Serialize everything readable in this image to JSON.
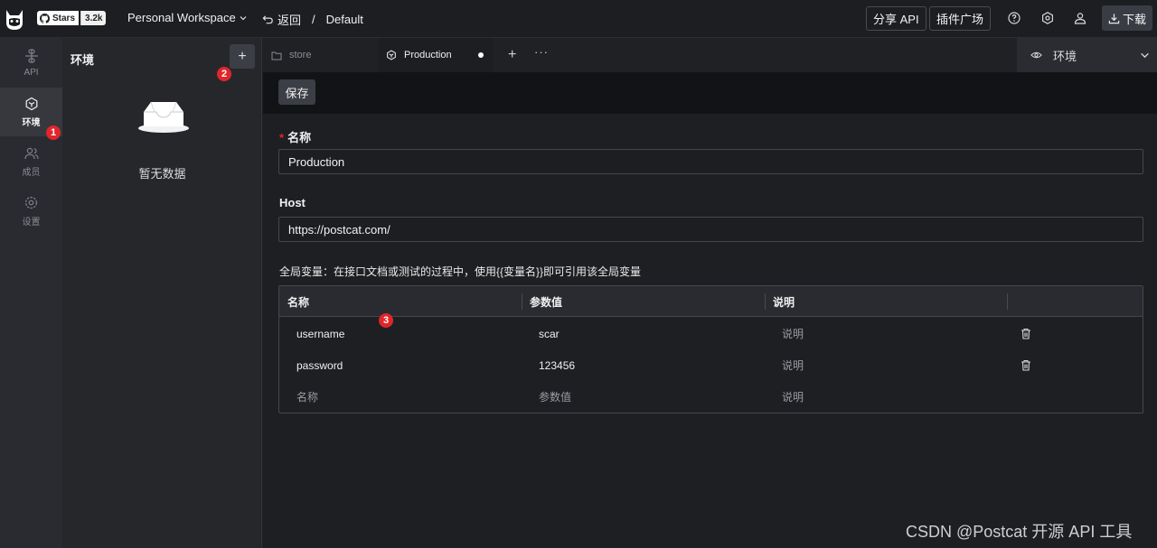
{
  "topbar": {
    "github_badge": {
      "label": "Stars",
      "count": "3.2k"
    },
    "workspace": "Personal Workspace",
    "back_label": "返回",
    "breadcrumb_separator": "/",
    "breadcrumb_current": "Default",
    "share_api": "分享 API",
    "plugin_market": "插件广场",
    "download": "下载",
    "icons": [
      "help-icon",
      "settings-icon",
      "user-icon",
      "download-icon"
    ]
  },
  "leftnav": {
    "items": [
      {
        "label": "API",
        "icon": "api-icon"
      },
      {
        "label": "环境",
        "icon": "environment-icon",
        "active": true
      },
      {
        "label": "成员",
        "icon": "members-icon"
      },
      {
        "label": "设置",
        "icon": "settings-icon"
      }
    ]
  },
  "env_panel": {
    "title": "环境",
    "add_label": "+",
    "empty_text": "暂无数据"
  },
  "annotations": [
    "1",
    "2",
    "3"
  ],
  "tabs": {
    "items": [
      {
        "label": "store",
        "icon": "folder-icon",
        "active": false
      },
      {
        "label": "Production",
        "icon": "environment-icon",
        "active": true,
        "unsaved": true
      }
    ],
    "add_label": "+",
    "more_label": "···",
    "env_select": "环境"
  },
  "toolbar": {
    "save_label": "保存"
  },
  "form": {
    "name_label": "名称",
    "name_value": "Production",
    "host_label": "Host",
    "host_value": "https://postcat.com/",
    "hint": "全局变量：在接口文档或测试的过程中，使用{{变量名}}即可引用该全局变量"
  },
  "variables": {
    "headers": [
      "名称",
      "参数值",
      "说明"
    ],
    "rows": [
      {
        "name": "username",
        "value": "scar",
        "desc": "说明"
      },
      {
        "name": "password",
        "value": "123456",
        "desc": "说明"
      }
    ],
    "placeholder": {
      "name": "名称",
      "value": "参数值",
      "desc": "说明"
    }
  },
  "watermark": "CSDN @Postcat 开源 API 工具",
  "colors": {
    "background": "#1e1f23",
    "sidebar": "#2a2b30",
    "badge_red": "#e0262b",
    "button": "#3c3e45"
  }
}
